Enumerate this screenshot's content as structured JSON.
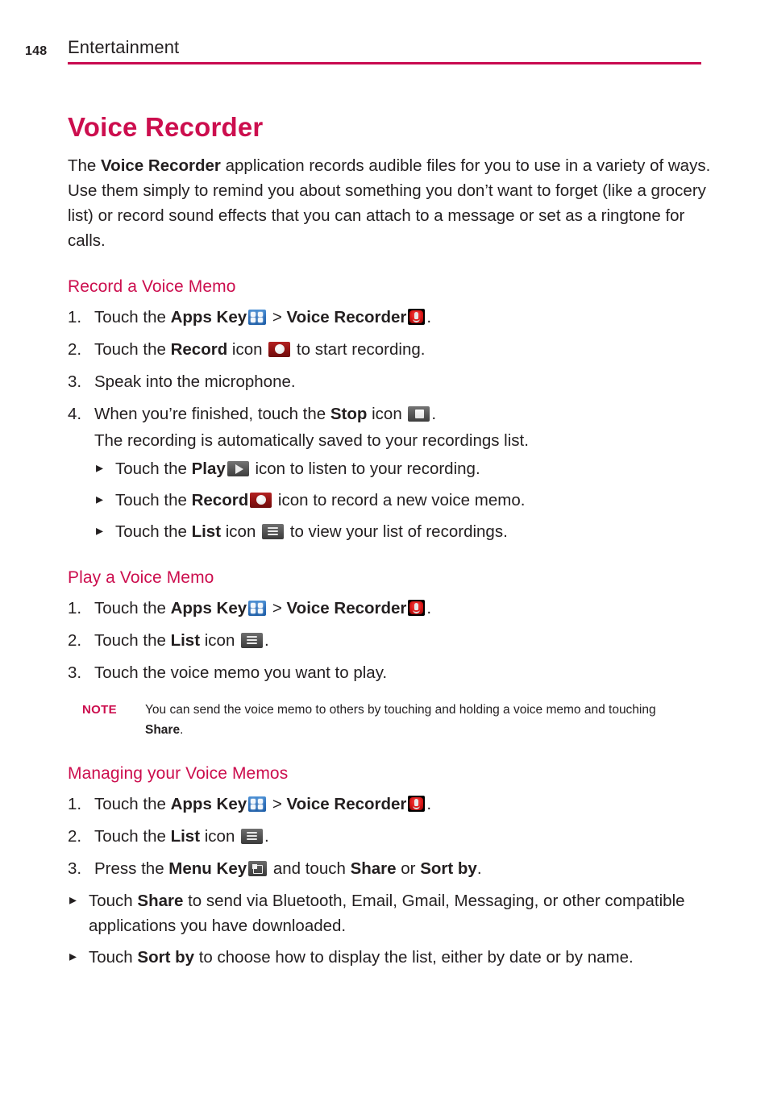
{
  "header": {
    "page_number": "148",
    "chapter": "Entertainment",
    "rule_color": "#c80a50"
  },
  "colors": {
    "accent": "#cc0e4e",
    "text": "#231f20"
  },
  "title": "Voice Recorder",
  "intro": {
    "part1": "The ",
    "bold1": "Voice Recorder",
    "part2": " application records audible files for you to use in a variety of ways. Use them simply to remind you about something you don’t want to forget (like a grocery list) or record sound effects that you can attach to a message or set as a ringtone for calls."
  },
  "sections": [
    {
      "heading": "Record a Voice Memo",
      "steps": [
        {
          "num": "1.",
          "parts": [
            "Touch the ",
            "Apps Key",
            " > ",
            "Voice Recorder",
            "."
          ],
          "icons": [
            "apps-key-icon",
            "voice-recorder-icon"
          ]
        },
        {
          "num": "2.",
          "parts": [
            "Touch the ",
            "Record",
            " icon ",
            " to start recording."
          ],
          "icons": [
            "record-icon"
          ]
        },
        {
          "num": "3.",
          "parts": [
            "Speak into the microphone."
          ],
          "icons": []
        },
        {
          "num": "4.",
          "parts": [
            "When you’re finished, touch the ",
            "Stop",
            " icon ",
            "."
          ],
          "icons": [
            "stop-icon"
          ],
          "substep": "The recording is automatically saved to your recordings list.",
          "bullets": [
            {
              "pre": "Touch the ",
              "bold": "Play",
              "mid": " ",
              "post": " icon to listen to your recording.",
              "icon": "play-icon"
            },
            {
              "pre": "Touch the ",
              "bold": "Record",
              "mid": " ",
              "post": " icon to record a new voice memo.",
              "icon": "record-icon"
            },
            {
              "pre": "Touch the ",
              "bold": "List",
              "mid": " icon ",
              "post": " to view your list of recordings.",
              "icon": "list-icon"
            }
          ]
        }
      ]
    },
    {
      "heading": "Play a Voice Memo",
      "steps": [
        {
          "num": "1.",
          "parts": [
            "Touch the ",
            "Apps Key",
            " > ",
            "Voice Recorder",
            "."
          ],
          "icons": [
            "apps-key-icon",
            "voice-recorder-icon"
          ]
        },
        {
          "num": "2.",
          "parts": [
            "Touch the ",
            "List",
            " icon ",
            "."
          ],
          "icons": [
            "list-icon"
          ]
        },
        {
          "num": "3.",
          "parts": [
            "Touch the voice memo you want to play."
          ],
          "icons": []
        }
      ],
      "note": {
        "label": "NOTE",
        "text_part1": "You can send the voice memo to others by touching and holding a voice memo and touching ",
        "text_bold": "Share",
        "text_part2": "."
      }
    },
    {
      "heading": "Managing your Voice Memos",
      "steps": [
        {
          "num": "1.",
          "parts": [
            "Touch the ",
            "Apps Key",
            " > ",
            "Voice Recorder",
            "."
          ],
          "icons": [
            "apps-key-icon",
            "voice-recorder-icon"
          ]
        },
        {
          "num": "2.",
          "parts": [
            "Touch the ",
            "List",
            " icon ",
            "."
          ],
          "icons": [
            "list-icon"
          ]
        },
        {
          "num": "3.",
          "parts": [
            "Press the ",
            "Menu Key",
            " and touch ",
            "Share",
            " or ",
            "Sort by",
            "."
          ],
          "icons": [
            "menu-key-icon"
          ]
        }
      ],
      "bullets": [
        {
          "pre": "Touch ",
          "bold": "Share",
          "post": " to send via Bluetooth, Email, Gmail, Messaging, or other compatible applications you have downloaded."
        },
        {
          "pre": "Touch ",
          "bold": "Sort by",
          "post": " to choose how to display the list, either by date or by name."
        }
      ]
    }
  ],
  "labels": {
    "touch_the": "Touch the ",
    "apps_key": "Apps Key",
    "gt": " > ",
    "voice_recorder": "Voice Recorder",
    "period": ".",
    "record": "Record",
    "icon_word": " icon ",
    "to_start_recording": " to start recording.",
    "speak_into_microphone": "Speak into the microphone.",
    "when_finished": "When you’re finished, touch the ",
    "stop": "Stop",
    "saved_note": "The recording is automatically saved to your recordings list.",
    "play": "Play",
    "list": "List",
    "menu_key": "Menu Key",
    "press_the": "Press the ",
    "and_touch": " and touch ",
    "share": "Share",
    "or": " or ",
    "sort_by": "Sort by",
    "touch_memo_to_play": "Touch the voice memo you want to play.",
    "touch_word": "Touch ",
    "play_listen_post": " icon to listen to your recording.",
    "record_new_post": " icon to record a new voice memo.",
    "list_view_post": " to view your list of recordings."
  }
}
